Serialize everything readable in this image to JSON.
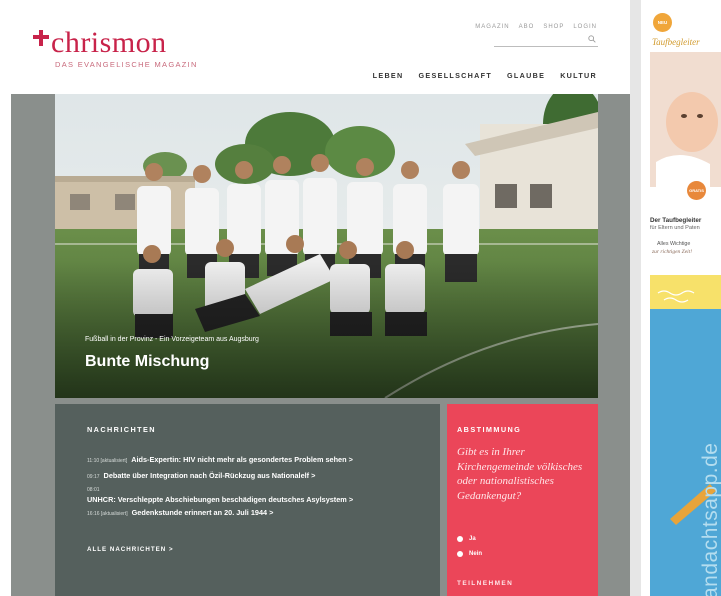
{
  "site": {
    "logo_text": "chrismon",
    "tagline": "DAS EVANGELISCHE MAGAZIN",
    "brand_color": "#c8234a"
  },
  "utility_nav": [
    "MAGAZIN",
    "ABO",
    "SHOP",
    "LOGIN"
  ],
  "search": {
    "value": "",
    "icon": "search-icon"
  },
  "main_nav": [
    "LEBEN",
    "GESELLSCHAFT",
    "GLAUBE",
    "KULTUR"
  ],
  "hero": {
    "kicker": "Fußball in der Provinz - Ein Vorzeigeteam aus Augsburg",
    "title": "Bunte Mischung"
  },
  "news": {
    "heading": "NACHRICHTEN",
    "items": [
      {
        "time": "11:10 [aktualisiert]",
        "headline": "Aids-Expertin: HIV nicht mehr als gesondertes Problem sehen >"
      },
      {
        "time": "09:17",
        "headline": "Debatte über Integration nach Özil-Rückzug aus Nationalelf >"
      },
      {
        "time": "08:01",
        "headline": "UNHCR: Verschleppte Abschiebungen beschädigen deutsches Asylsystem >"
      },
      {
        "time": "16:16 [aktualisiert]",
        "headline": "Gedenkstunde erinnert an 20. Juli 1944 >"
      }
    ],
    "all_link": "ALLE NACHRICHTEN >",
    "bg_color": "#55605d"
  },
  "poll": {
    "heading": "ABSTIMMUNG",
    "question": "Gibt es in Ihrer Kirchengemeinde völkisches oder nationalistisches Gedankengut?",
    "options": [
      "Ja",
      "Nein"
    ],
    "submit": "TEILNEHMEN",
    "bg_color": "#eb4659"
  },
  "ad": {
    "badge": "NEU",
    "script_title": "Taufbegleiter",
    "burst": "GRATIS",
    "line1": "Der Taufbegleiter",
    "line2": "für Eltern und Paten",
    "line3": "Alles Wichtige",
    "line4": "zur richtigen Zeit!",
    "vertical_text": "andachtsapp.de"
  }
}
